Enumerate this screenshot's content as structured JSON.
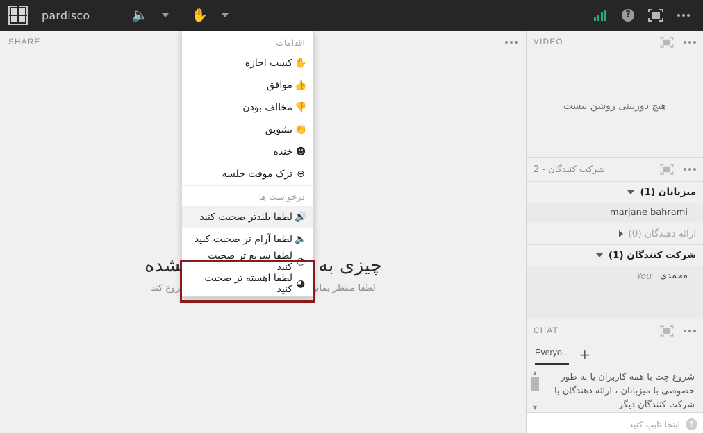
{
  "topbar": {
    "app_title": "pardisco",
    "logo_icon": "pardisco-logo-icon",
    "speaker_icon": "speaker-on-icon",
    "speaker_chevron_icon": "chevron-down-icon",
    "hand_icon": "raise-hand-icon",
    "hand_chevron_icon": "chevron-down-icon",
    "signal_icon": "connection-strength-icon",
    "help_icon": "help-question-icon",
    "help_glyph": "?",
    "screen_icon": "fullscreen-icon",
    "overflow_icon": "more-options-icon",
    "accent_green": "#27ae75",
    "bar_bg": "#262626"
  },
  "share": {
    "panel_title": "SHARE",
    "overflow_icon": "more-options-icon",
    "graphic_icon": "share-arrow-icon",
    "empty_title": "چیزی به اشتراک گذاشته نشده",
    "empty_subtitle": "لطفا منتظر بمانید تا ارائه دهنده اشتراک گذاری را شروع کند"
  },
  "menu": {
    "header": "اقدامات",
    "items": [
      {
        "label": "کسب اجازه",
        "icon": "raise-hand-icon",
        "glyph": "✋",
        "hover": false
      },
      {
        "label": "موافق",
        "icon": "thumbs-up-icon",
        "glyph": "👍",
        "hover": false
      },
      {
        "label": "مخالف بودن",
        "icon": "thumbs-down-icon",
        "glyph": "👎",
        "hover": false
      },
      {
        "label": "تشویق",
        "icon": "applause-icon",
        "glyph": "👏",
        "hover": false
      },
      {
        "label": "خنده",
        "icon": "laugh-icon",
        "glyph": "☻",
        "hover": false
      },
      {
        "label": "ترک موقت جلسه",
        "icon": "step-away-icon",
        "glyph": "⊖",
        "hover": false
      }
    ],
    "requests_header": "درخواست ها",
    "requests": [
      {
        "label": "لطفا بلندتر صحبت کنید",
        "icon": "speak-louder-icon",
        "glyph": "🔊",
        "hover": true
      },
      {
        "label": "لطفا آرام تر صحبت کنید",
        "icon": "speak-quieter-icon",
        "glyph": "🔈",
        "hover": false
      },
      {
        "label": "لطفا سریع تر صحبت کنید",
        "icon": "speak-faster-icon",
        "glyph": "◔",
        "hover": false
      },
      {
        "label": "لطفا اهسته تر صحبت کنید",
        "icon": "speak-slower-icon",
        "glyph": "◕",
        "hover": false
      }
    ],
    "highlight_color": "#8b1a1a"
  },
  "video": {
    "panel_title": "VIDEO",
    "expand_icon": "fullscreen-icon",
    "overflow_icon": "more-options-icon",
    "empty_message": "هیچ دوربینی روشن نیست"
  },
  "participants": {
    "panel_title": "شرکت کنندگان  -  2",
    "expand_icon": "fullscreen-icon",
    "overflow_icon": "more-options-icon",
    "groups": [
      {
        "name": "میزبانان (1)",
        "expanded": true,
        "caret_icon": "chevron-down-icon",
        "muted": false,
        "members": [
          {
            "name": "marjane bahrami",
            "rtl": false,
            "you": ""
          }
        ]
      },
      {
        "name": "ارائه دهندگان (0)",
        "expanded": false,
        "caret_icon": "chevron-right-icon",
        "muted": true,
        "members": []
      },
      {
        "name": "شرکت کنندگان (1)",
        "expanded": true,
        "caret_icon": "chevron-down-icon",
        "muted": false,
        "members": [
          {
            "name": "محمدی",
            "rtl": true,
            "you": "You"
          }
        ]
      }
    ]
  },
  "chat": {
    "panel_title": "CHAT",
    "expand_icon": "fullscreen-icon",
    "overflow_icon": "more-options-icon",
    "tab_label": "Everyo...",
    "add_tab_glyph": "+",
    "add_tab_icon": "add-chat-tab-icon",
    "scroll_up_glyph": "▲",
    "scroll_down_glyph": "▼",
    "message": "شروع چت با همه کاربران یا به طور خصوصی با میزبانان ، ارائه دهندگان یا شرکت کنندگان دیگر",
    "input_placeholder": "اینجا تایپ کنید",
    "send_icon": "send-up-icon",
    "send_glyph": "↑"
  }
}
